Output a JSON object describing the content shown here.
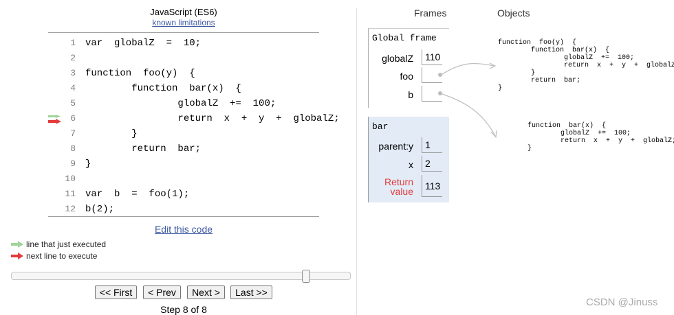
{
  "header": {
    "language": "JavaScript (ES6)",
    "limitations_link": "known limitations"
  },
  "code": {
    "lines": [
      {
        "num": "1",
        "text": "var  globalZ  =  10;"
      },
      {
        "num": "2",
        "text": ""
      },
      {
        "num": "3",
        "text": "function  foo(y)  {"
      },
      {
        "num": "4",
        "text": "        function  bar(x)  {"
      },
      {
        "num": "5",
        "text": "                globalZ  +=  100;"
      },
      {
        "num": "6",
        "text": "                return  x  +  y  +  globalZ;"
      },
      {
        "num": "7",
        "text": "        }"
      },
      {
        "num": "8",
        "text": "        return  bar;"
      },
      {
        "num": "9",
        "text": "}"
      },
      {
        "num": "10",
        "text": ""
      },
      {
        "num": "11",
        "text": "var  b  =  foo(1);"
      },
      {
        "num": "12",
        "text": "b(2);"
      }
    ],
    "edit_link": "Edit this code",
    "next_line": 6,
    "prev_line": 6
  },
  "legend": {
    "just_executed": "line that just executed",
    "next_to_execute": "next line to execute",
    "just_executed_color": "#9ed49a",
    "next_color": "#e33b3b"
  },
  "navigation": {
    "first": "<< First",
    "prev": "< Prev",
    "next": "Next >",
    "last": "Last >>",
    "step_label": "Step 8 of 8",
    "current_step": 8,
    "total_steps": 8
  },
  "visualizer": {
    "frames_header": "Frames",
    "objects_header": "Objects",
    "global_frame": {
      "title": "Global frame",
      "vars": [
        {
          "name": "globalZ",
          "value": "110"
        },
        {
          "name": "foo",
          "value": ""
        },
        {
          "name": "b",
          "value": ""
        }
      ]
    },
    "bar_frame": {
      "title": "bar",
      "vars": [
        {
          "name": "parent:y",
          "value": "1"
        },
        {
          "name": "x",
          "value": "2"
        }
      ],
      "return_label_1": "Return",
      "return_label_2": "value",
      "return_value": "113"
    },
    "objects": {
      "foo_code": "function  foo(y)  {\n        function  bar(x)  {\n                globalZ  +=  100;\n                return  x  +  y  +  globalZ;\n        }\n        return  bar;\n}",
      "bar_code": "function  bar(x)  {\n        globalZ  +=  100;\n        return  x  +  y  +  globalZ;\n}"
    }
  },
  "watermark": "CSDN @Jinuss"
}
